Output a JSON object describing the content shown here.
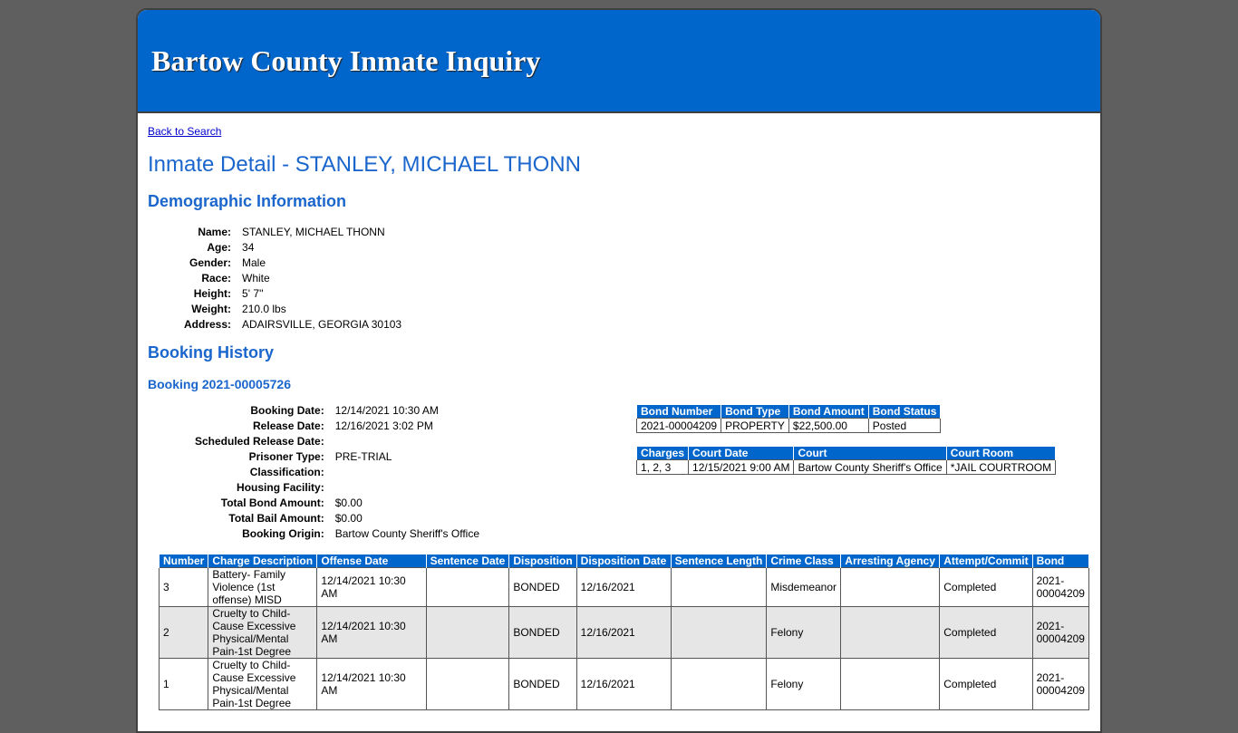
{
  "banner": {
    "title": "Bartow County Inmate Inquiry"
  },
  "nav": {
    "back_label": "Back to Search"
  },
  "page": {
    "title": "Inmate Detail - STANLEY, MICHAEL THONN"
  },
  "demographics": {
    "heading": "Demographic Information",
    "fields": [
      {
        "label": "Name:",
        "value": "STANLEY, MICHAEL THONN"
      },
      {
        "label": "Age:",
        "value": "34"
      },
      {
        "label": "Gender:",
        "value": "Male"
      },
      {
        "label": "Race:",
        "value": "White"
      },
      {
        "label": "Height:",
        "value": "5' 7''"
      },
      {
        "label": "Weight:",
        "value": "210.0 lbs"
      },
      {
        "label": "Address:",
        "value": "ADAIRSVILLE, GEORGIA 30103"
      }
    ]
  },
  "booking_history": {
    "heading": "Booking History",
    "booking_heading": "Booking 2021-00005726",
    "fields": [
      {
        "label": "Booking Date:",
        "value": "12/14/2021 10:30 AM"
      },
      {
        "label": "Release Date:",
        "value": "12/16/2021 3:02 PM"
      },
      {
        "label": "Scheduled Release Date:",
        "value": ""
      },
      {
        "label": "Prisoner Type:",
        "value": "PRE-TRIAL"
      },
      {
        "label": "Classification:",
        "value": ""
      },
      {
        "label": "Housing Facility:",
        "value": ""
      },
      {
        "label": "Total Bond Amount:",
        "value": "$0.00"
      },
      {
        "label": "Total Bail Amount:",
        "value": "$0.00"
      },
      {
        "label": "Booking Origin:",
        "value": "Bartow County Sheriff's Office"
      }
    ],
    "bond_table": {
      "headers": [
        "Bond Number",
        "Bond Type",
        "Bond Amount",
        "Bond Status"
      ],
      "rows": [
        [
          "2021-00004209",
          "PROPERTY",
          "$22,500.00",
          "Posted"
        ]
      ]
    },
    "court_table": {
      "headers": [
        "Charges",
        "Court Date",
        "Court",
        "Court Room"
      ],
      "rows": [
        [
          "1, 2, 3",
          "12/15/2021 9:00 AM",
          "Bartow County Sheriff's Office",
          "*JAIL COURTROOM"
        ]
      ]
    },
    "charges_table": {
      "headers": [
        "Number",
        "Charge Description",
        "Offense Date",
        "Sentence Date",
        "Disposition",
        "Disposition Date",
        "Sentence Length",
        "Crime Class",
        "Arresting Agency",
        "Attempt/Commit",
        "Bond"
      ],
      "rows": [
        [
          "3",
          "Battery- Family Violence (1st offense) MISD",
          "12/14/2021 10:30 AM",
          "",
          "BONDED",
          "12/16/2021",
          "",
          "Misdemeanor",
          "",
          "Completed",
          "2021-00004209"
        ],
        [
          "2",
          "Cruelty to Child- Cause Excessive Physical/Mental Pain-1st Degree",
          "12/14/2021 10:30 AM",
          "",
          "BONDED",
          "12/16/2021",
          "",
          "Felony",
          "",
          "Completed",
          "2021-00004209"
        ],
        [
          "1",
          "Cruelty to Child- Cause Excessive Physical/Mental Pain-1st Degree",
          "12/14/2021 10:30 AM",
          "",
          "BONDED",
          "12/16/2021",
          "",
          "Felony",
          "",
          "Completed",
          "2021-00004209"
        ]
      ]
    }
  }
}
